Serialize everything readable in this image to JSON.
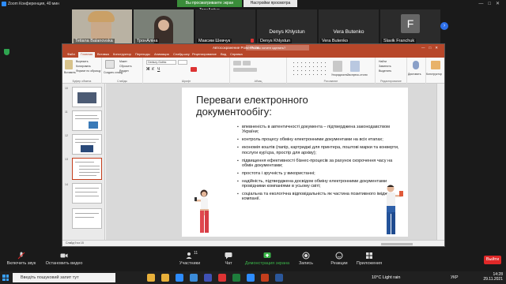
{
  "zoom": {
    "window_title": "Zoom Конференция, 40 мин",
    "share_banner": "Вы просматриваете экран ТронАлёна",
    "view_settings": "Настройки просмотра",
    "participants": [
      {
        "name": "Tetiana Balanovska"
      },
      {
        "name": "ТронАліна"
      },
      {
        "name": "Максим Шевчук"
      },
      {
        "name": "Denys Khlystun"
      },
      {
        "name": "Vera Butenko"
      },
      {
        "name": "Slavik Franchuk",
        "initial": "F"
      }
    ],
    "bottom_bar": {
      "mute": "Включить звук",
      "video": "Остановить видео",
      "participants": "Участники",
      "participants_count": "11",
      "chat": "Чат",
      "share": "Демонстрация экрана",
      "record": "Запись",
      "reactions": "Реакции",
      "apps": "Приложения",
      "end": "Выйти"
    }
  },
  "powerpoint": {
    "doc_title": "Автосохранение   PowerPoint",
    "search_placeholder": "Что вы хотите сделать?",
    "tabs": [
      "Файл",
      "Главная",
      "Вставка",
      "Конструктор",
      "Переходы",
      "Анимация",
      "Слайд-шоу",
      "Рецензирование",
      "Вид",
      "Справка"
    ],
    "ribbon": {
      "paste": "Вставить",
      "cut": "Вырезать",
      "copy": "Копировать",
      "format": "Формат по образцу",
      "new_slide": "Создать слайд",
      "reuse": "Повторно использовать слайды",
      "layout": "Макет",
      "reset": "Сбросить",
      "section": "Раздел",
      "font_value": "Century Gothic",
      "group_labels": [
        "Буфер обмена",
        "Слайды",
        "Шрифт",
        "Абзац",
        "Рисование",
        "Редактирование"
      ],
      "arrange": "Упорядочить",
      "quick_styles": "Экспресс-стили",
      "find": "Найти",
      "replace": "Заменить",
      "select": "Выделить",
      "dictate": "Диктовать",
      "designer": "Конструктор"
    },
    "thumbnails": [
      {
        "num": "10"
      },
      {
        "num": "11"
      },
      {
        "num": "12"
      },
      {
        "num": "13"
      },
      {
        "num": "14"
      }
    ],
    "slide": {
      "title": "Переваги електронного документообігу:",
      "bullets": [
        "впевненість в автентичності документа – підтверджена законодавством України;",
        "контроль процесу обміну електронними документами на всіх етапах;",
        "економія коштів (папір, картриджі для принтера, поштові марки та конверти, послуги кур'єра, простір для архіву);",
        "підвищення ефективності бізнес-процесів за рахунок скорочення часу на обмін документами;",
        "простота і зручність у використанні;",
        "надійність, підтверджена досвідом обміну електронними документами провідними компаніями в усьому світі;",
        "соціальна та екологічна відповідальність як частина позитивного іміджу компанії."
      ]
    },
    "status": "Слайд 9 из 15"
  },
  "taskbar": {
    "search_placeholder": "Введіть пошуковий запит тут",
    "weather": "10°C  Light rain",
    "lang": "УКР",
    "time": "14:28",
    "date": "29.11.2021"
  }
}
